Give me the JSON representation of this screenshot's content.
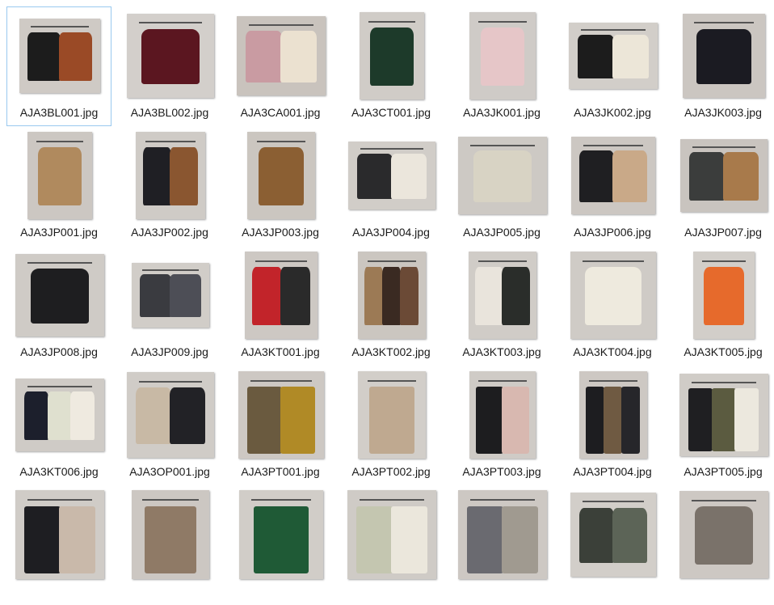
{
  "files": [
    {
      "name": "AJA3BL001.jpg",
      "selected": true,
      "bg": "#cfcac5",
      "items": [
        {
          "c": "#1c1c1c",
          "t": "top"
        },
        {
          "c": "#9a4a26",
          "t": "top"
        }
      ]
    },
    {
      "name": "AJA3BL002.jpg",
      "bg": "#d3cfcb",
      "items": [
        {
          "c": "#5b1620",
          "t": "top"
        }
      ]
    },
    {
      "name": "AJA3CA001.jpg",
      "bg": "#c9c3bd",
      "items": [
        {
          "c": "#c99ba2",
          "t": "top"
        },
        {
          "c": "#ebe1d0",
          "t": "top"
        }
      ]
    },
    {
      "name": "AJA3CT001.jpg",
      "bg": "#d0ccc7",
      "items": [
        {
          "c": "#1d3a2a",
          "t": "top"
        }
      ]
    },
    {
      "name": "AJA3JK001.jpg",
      "bg": "#cfcbc7",
      "items": [
        {
          "c": "#e6c6c8",
          "t": "top"
        }
      ]
    },
    {
      "name": "AJA3JK002.jpg",
      "bg": "#d2cec9",
      "items": [
        {
          "c": "#1c1c1c",
          "t": "top"
        },
        {
          "c": "#ece6d8",
          "t": "top"
        }
      ]
    },
    {
      "name": "AJA3JK003.jpg",
      "bg": "#cbc6c1",
      "items": [
        {
          "c": "#1b1b22",
          "t": "top"
        }
      ]
    },
    {
      "name": "AJA3JP001.jpg",
      "bg": "#ccc7c2",
      "items": [
        {
          "c": "#b08a5e",
          "t": "top"
        }
      ]
    },
    {
      "name": "AJA3JP002.jpg",
      "bg": "#cfcbc6",
      "items": [
        {
          "c": "#1f1f24",
          "t": "top"
        },
        {
          "c": "#8a5630",
          "t": "top"
        }
      ]
    },
    {
      "name": "AJA3JP003.jpg",
      "bg": "#cbc6c0",
      "items": [
        {
          "c": "#8b5f33",
          "t": "top"
        }
      ]
    },
    {
      "name": "AJA3JP004.jpg",
      "bg": "#d1cdc8",
      "items": [
        {
          "c": "#2a2a2c",
          "t": "top"
        },
        {
          "c": "#ebe6dc",
          "t": "top"
        }
      ]
    },
    {
      "name": "AJA3JP005.jpg",
      "bg": "#cdc9c4",
      "items": [
        {
          "c": "#d8d3c4",
          "t": "top"
        }
      ]
    },
    {
      "name": "AJA3JP006.jpg",
      "bg": "#ccc7c2",
      "items": [
        {
          "c": "#1f1f22",
          "t": "top"
        },
        {
          "c": "#c9a988",
          "t": "top"
        }
      ]
    },
    {
      "name": "AJA3JP007.jpg",
      "bg": "#c9c4bf",
      "items": [
        {
          "c": "#3b3d3c",
          "t": "top"
        },
        {
          "c": "#a87a4b",
          "t": "top"
        }
      ]
    },
    {
      "name": "AJA3JP008.jpg",
      "bg": "#cfcbc6",
      "items": [
        {
          "c": "#1e1e20",
          "t": "top"
        }
      ]
    },
    {
      "name": "AJA3JP009.jpg",
      "bg": "#d1cdc8",
      "items": [
        {
          "c": "#3a3b40",
          "t": "top"
        },
        {
          "c": "#4d4e56",
          "t": "top"
        }
      ]
    },
    {
      "name": "AJA3KT001.jpg",
      "bg": "#cdc8c3",
      "items": [
        {
          "c": "#c2242a",
          "t": "top"
        },
        {
          "c": "#2a2a2a",
          "t": "top"
        }
      ]
    },
    {
      "name": "AJA3KT002.jpg",
      "bg": "#cbc6c0",
      "items": [
        {
          "c": "#9c7a55",
          "t": "top"
        },
        {
          "c": "#3a2a22",
          "t": "top"
        },
        {
          "c": "#6b4a36",
          "t": "top"
        }
      ]
    },
    {
      "name": "AJA3KT003.jpg",
      "bg": "#d0ccc7",
      "items": [
        {
          "c": "#e9e4dc",
          "t": "top"
        },
        {
          "c": "#2a2d2a",
          "t": "top"
        }
      ]
    },
    {
      "name": "AJA3KT004.jpg",
      "bg": "#cfcbc6",
      "items": [
        {
          "c": "#eeeade",
          "t": "top"
        }
      ]
    },
    {
      "name": "AJA3KT005.jpg",
      "bg": "#d2cec9",
      "items": [
        {
          "c": "#e66a2c",
          "t": "top"
        }
      ]
    },
    {
      "name": "AJA3KT006.jpg",
      "bg": "#cfcbc6",
      "items": [
        {
          "c": "#1c1f2c",
          "t": "top"
        },
        {
          "c": "#dfe0cf",
          "t": "top"
        },
        {
          "c": "#efeae0",
          "t": "top"
        }
      ]
    },
    {
      "name": "AJA3OP001.jpg",
      "bg": "#d0ccc7",
      "items": [
        {
          "c": "#c8b9a5",
          "t": "top"
        },
        {
          "c": "#222226",
          "t": "top"
        }
      ]
    },
    {
      "name": "AJA3PT001.jpg",
      "bg": "#cdc8c3",
      "items": [
        {
          "c": "#6a5a3f",
          "t": "pant"
        },
        {
          "c": "#b08a26",
          "t": "pant"
        }
      ]
    },
    {
      "name": "AJA3PT002.jpg",
      "bg": "#d2cec9",
      "items": [
        {
          "c": "#bfa990",
          "t": "pant"
        }
      ]
    },
    {
      "name": "AJA3PT003.jpg",
      "bg": "#cfcbc6",
      "items": [
        {
          "c": "#1d1d1f",
          "t": "pant"
        },
        {
          "c": "#d8b8b0",
          "t": "pant"
        }
      ]
    },
    {
      "name": "AJA3PT004.jpg",
      "bg": "#cdc8c3",
      "items": [
        {
          "c": "#1d1d20",
          "t": "pant"
        },
        {
          "c": "#6f5a42",
          "t": "pant"
        },
        {
          "c": "#26262a",
          "t": "pant"
        }
      ]
    },
    {
      "name": "AJA3PT005.jpg",
      "bg": "#d0ccc7",
      "items": [
        {
          "c": "#1f1f22",
          "t": "pant"
        },
        {
          "c": "#5b5b40",
          "t": "pant"
        },
        {
          "c": "#ece8de",
          "t": "pant"
        }
      ]
    },
    {
      "name": "",
      "bg": "#d0ccc7",
      "items": [
        {
          "c": "#1e1e22",
          "t": "pant"
        },
        {
          "c": "#c9b9aa",
          "t": "pant"
        }
      ]
    },
    {
      "name": "",
      "bg": "#ccc7c2",
      "items": [
        {
          "c": "#8f7a66",
          "t": "pant"
        }
      ]
    },
    {
      "name": "",
      "bg": "#d1cdc8",
      "items": [
        {
          "c": "#1f5a36",
          "t": "pant"
        }
      ]
    },
    {
      "name": "",
      "bg": "#cfcbc6",
      "items": [
        {
          "c": "#c4c6b0",
          "t": "pant"
        },
        {
          "c": "#ebe7dc",
          "t": "pant"
        }
      ]
    },
    {
      "name": "",
      "bg": "#cdc8c3",
      "items": [
        {
          "c": "#6a6a70",
          "t": "pant"
        },
        {
          "c": "#a09a90",
          "t": "pant"
        }
      ]
    },
    {
      "name": "",
      "bg": "#d2cec9",
      "items": [
        {
          "c": "#3b4039",
          "t": "top"
        },
        {
          "c": "#5c6457",
          "t": "top"
        }
      ]
    },
    {
      "name": "",
      "bg": "#cdc8c3",
      "items": [
        {
          "c": "#7a726a",
          "t": "top"
        }
      ]
    }
  ]
}
